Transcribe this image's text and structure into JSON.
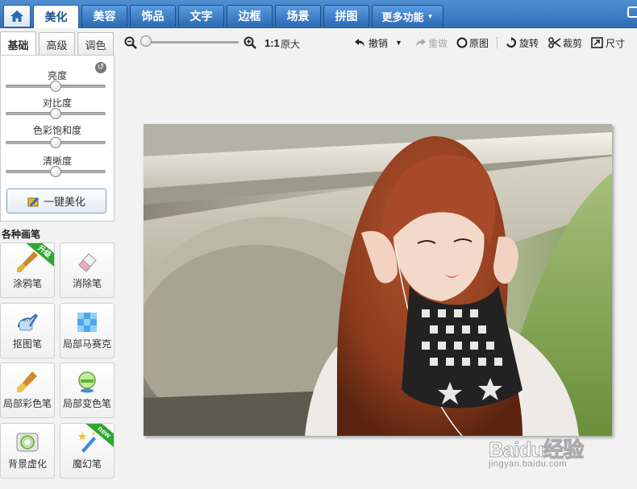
{
  "nav": {
    "tabs": [
      "美化",
      "美容",
      "饰品",
      "文字",
      "边框",
      "场景",
      "拼图"
    ],
    "more": "更多功能",
    "active_index": 0
  },
  "subtabs": [
    "基础",
    "高级",
    "调色"
  ],
  "sliders": [
    {
      "label": "亮度",
      "value": 0.5
    },
    {
      "label": "对比度",
      "value": 0.5
    },
    {
      "label": "色彩饱和度",
      "value": 0.5
    },
    {
      "label": "清晰度",
      "value": 0.5
    }
  ],
  "one_key": "一键美化",
  "brush_title": "各种画笔",
  "brushes": [
    {
      "label": "涂鸦笔",
      "icon": "paint-brush-icon",
      "badge": "升级"
    },
    {
      "label": "消除笔",
      "icon": "eraser-icon",
      "badge": ""
    },
    {
      "label": "抠图笔",
      "icon": "cutout-pen-icon",
      "badge": ""
    },
    {
      "label": "局部马赛克",
      "icon": "mosaic-icon",
      "badge": ""
    },
    {
      "label": "局部彩色笔",
      "icon": "color-brush-icon",
      "badge": ""
    },
    {
      "label": "局部变色笔",
      "icon": "color-change-icon",
      "badge": ""
    },
    {
      "label": "背景虚化",
      "icon": "blur-background-icon",
      "badge": ""
    },
    {
      "label": "魔幻笔",
      "icon": "magic-wand-icon",
      "badge": "new"
    }
  ],
  "toolbar": {
    "ratio": "1:1",
    "original_size": "原大",
    "undo": "撤销",
    "redo": "重做",
    "original": "原图",
    "rotate": "旋转",
    "crop": "裁剪",
    "resize": "尺寸",
    "zoom_level": 0.0
  },
  "watermark": {
    "logo": "Baidu经验",
    "url": "jingyan.baidu.com"
  },
  "colors": {
    "nav_blue": "#2f6eb5",
    "badge_green": "#2fa82f"
  }
}
